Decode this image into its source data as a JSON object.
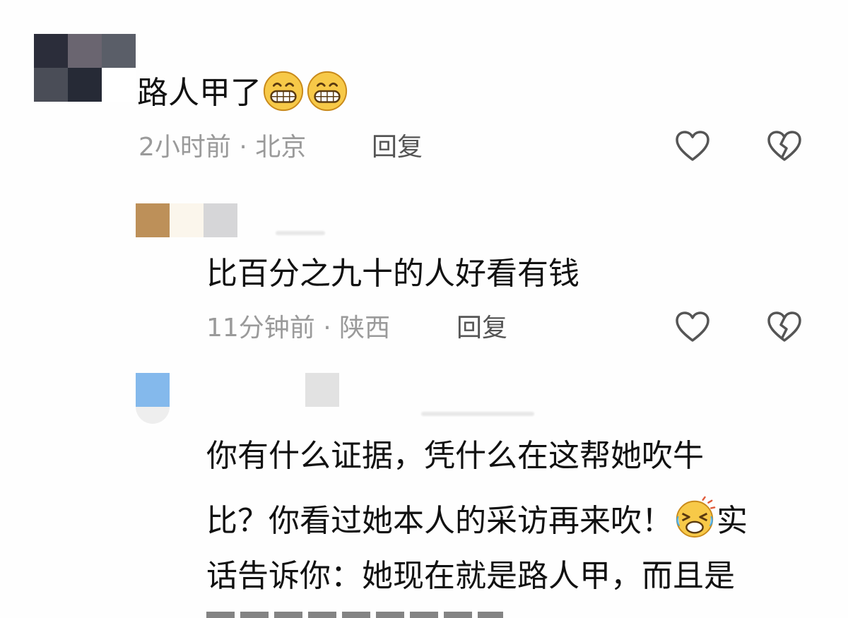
{
  "colors": {
    "text": "#111111",
    "meta": "#9a9a9a",
    "reply": "#555555",
    "icon_stroke": "#555555",
    "emoji_yellow": "#f7c948"
  },
  "comments": [
    {
      "text": "路人甲了",
      "emojis": [
        "grin-emoji",
        "grin-emoji"
      ],
      "time": "2小时前",
      "separator": "·",
      "location": "北京",
      "reply_label": "回复",
      "like_icon": "heart-outline-icon",
      "dislike_icon": "broken-heart-icon"
    },
    {
      "text": "比百分之九十的人好看有钱",
      "time": "11分钟前",
      "separator": "·",
      "location": "陕西",
      "reply_label": "回复",
      "like_icon": "heart-outline-icon",
      "dislike_icon": "broken-heart-icon"
    },
    {
      "lines": [
        "你有什么证据，凭什么在这帮她吹牛",
        "比？你看过她本人的采访再来吹！",
        "实",
        "话告诉你：她现在就是路人甲，而且是"
      ],
      "emoji": "crying-laughing-emoji"
    }
  ]
}
